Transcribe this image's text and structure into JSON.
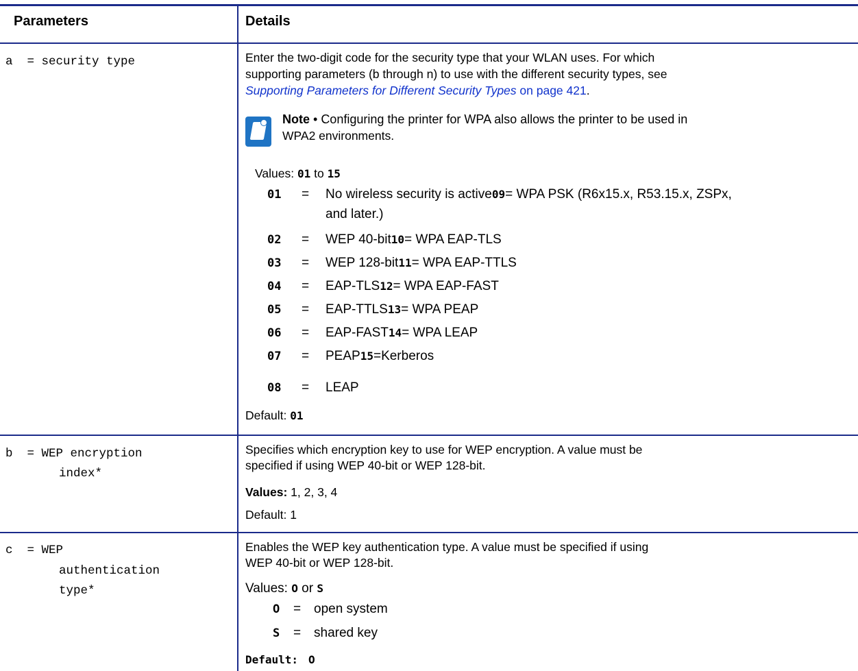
{
  "headers": {
    "parameters": "Parameters",
    "details": "Details"
  },
  "rows": {
    "a": {
      "param_line1": "a  = security type",
      "desc_1": "Enter the two-digit code for the security type that your WLAN uses. For which",
      "desc_2": "supporting parameters (b through n) to use with the different security types, see",
      "link_text": "Supporting Parameters for Different Security Types",
      "link_suffix": " on page 421",
      "period": ".",
      "note_label": "Note",
      "note_bullet": " • ",
      "note_text_1": "Configuring the printer for WPA also allows the printer to be used in",
      "note_text_2": "WPA2 environments.",
      "values_label": "Values:",
      "values_from": "01",
      "values_to": "to",
      "values_end": "15",
      "codes": [
        {
          "k": "01",
          "eq": "=",
          "v1": "No wireless security is active",
          "k2": "09",
          "v2": "= WPA PSK (R6x15.x, R53.15.x, ZSPx,",
          "v3": "and later.)"
        },
        {
          "k": "02",
          "eq": "=",
          "v1": "WEP 40-bit",
          "k2": "10",
          "v2": "= WPA EAP-TLS"
        },
        {
          "k": "03",
          "eq": "=",
          "v1": "WEP 128-bit",
          "k2": "11",
          "v2": "= WPA EAP-TTLS"
        },
        {
          "k": "04",
          "eq": "=",
          "v1": "EAP-TLS",
          "k2": "12",
          "v2": "= WPA EAP-FAST"
        },
        {
          "k": "05",
          "eq": "=",
          "v1": "EAP-TTLS",
          "k2": "13",
          "v2": "= WPA PEAP"
        },
        {
          "k": "06",
          "eq": "=",
          "v1": "EAP-FAST",
          "k2": "14",
          "v2": "= WPA LEAP"
        },
        {
          "k": "07",
          "eq": "=",
          "v1": "PEAP",
          "k2": "15",
          "v2": "=Kerberos"
        },
        {
          "k": "08",
          "eq": "=",
          "v1": "LEAP",
          "k2": "",
          "v2": ""
        }
      ],
      "default_label": "Default:",
      "default_value": "01"
    },
    "b": {
      "param_line1": "b  = WEP encryption",
      "param_line2": "index*",
      "desc_1": "Specifies which encryption key to use for WEP encryption. A value must be",
      "desc_2": "specified if using WEP 40-bit or WEP 128-bit.",
      "values_label": "Values:",
      "values_value": "1, 2, 3, 4",
      "default_label": "Default:",
      "default_value": "1"
    },
    "c": {
      "param_line1": "c  = WEP",
      "param_line2": "authentication",
      "param_line3": "type*",
      "desc_1": "Enables the WEP key authentication type. A value must be specified if using",
      "desc_2": "WEP 40-bit or WEP 128-bit.",
      "values_label": "Values:",
      "values_o": "O",
      "values_or": "or",
      "values_s": "S",
      "codes": [
        {
          "k": "O",
          "eq": "=",
          "v1": "open system"
        },
        {
          "k": "S",
          "eq": "=",
          "v1": "shared key"
        }
      ],
      "default_label": "Default:",
      "default_value": "O"
    }
  }
}
